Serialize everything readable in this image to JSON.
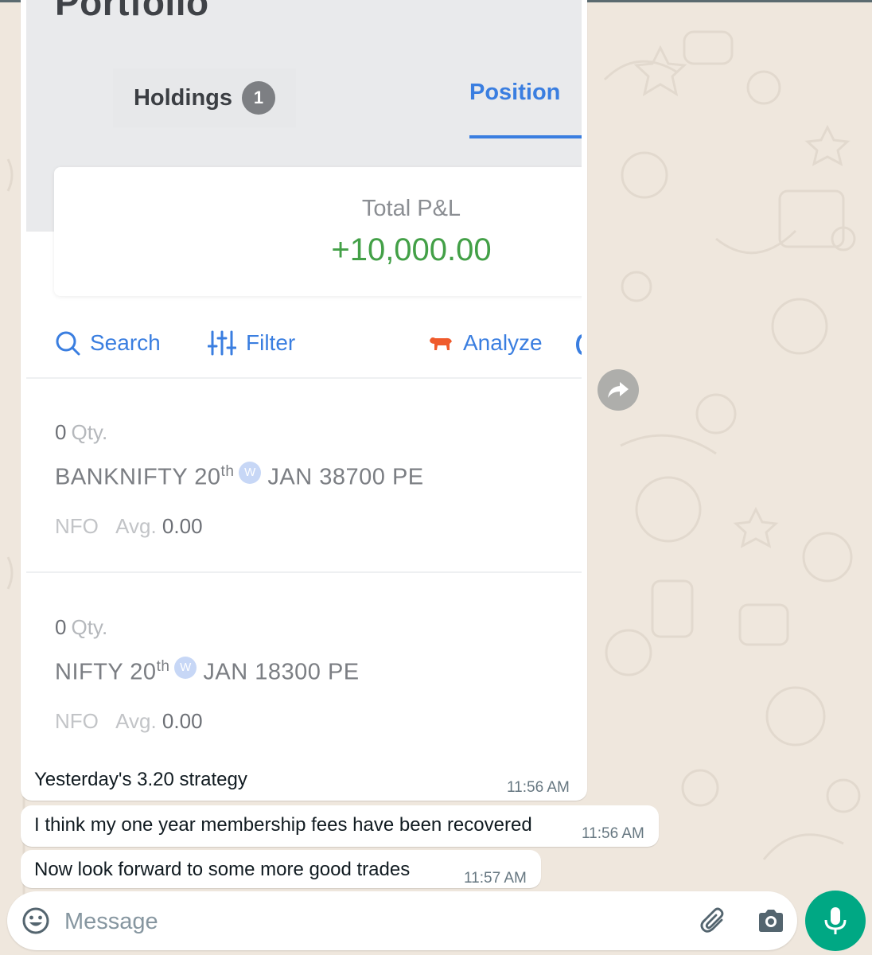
{
  "screenshot": {
    "title": "Portfolio",
    "tabs": {
      "holdings_label": "Holdings",
      "holdings_count": "1",
      "positions_label": "Position"
    },
    "pnl": {
      "label": "Total P&L",
      "value": "+10,000.00",
      "value_color": "#43a047"
    },
    "toolbar": {
      "search": "Search",
      "filter": "Filter",
      "analyze": "Analyze"
    },
    "positions": [
      {
        "qty": "0",
        "qty_unit": "Qty.",
        "symbol": "BANKNIFTY 20",
        "ordinal": "th",
        "weekly_badge": "W",
        "expiry": "JAN 38700 PE",
        "exchange": "NFO",
        "avg_label": "Avg.",
        "avg_value": "0.00"
      },
      {
        "qty": "0",
        "qty_unit": "Qty.",
        "symbol": "NIFTY 20",
        "ordinal": "th",
        "weekly_badge": "W",
        "expiry": "JAN 18300 PE",
        "exchange": "NFO",
        "avg_label": "Avg.",
        "avg_value": "0.00"
      }
    ],
    "accent_color": "#3a7ee0"
  },
  "chat": {
    "image_caption": "Yesterday's 3.20 strategy",
    "image_time": "11:56 AM",
    "messages": [
      {
        "text": "I think my one year membership fees have been recovered",
        "time": "11:56 AM"
      },
      {
        "text": "Now look forward to some more good trades",
        "time": "11:57 AM"
      }
    ]
  },
  "composer": {
    "placeholder": "Message",
    "icons": [
      "emoji-icon",
      "attach-icon",
      "camera-icon",
      "mic-icon"
    ],
    "mic_color": "#00a884"
  },
  "forward_icon": "forward-icon",
  "wallpaper_color": "#efe7dd"
}
